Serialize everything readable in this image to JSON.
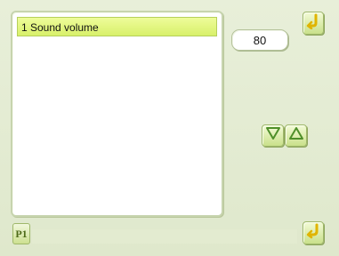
{
  "list": {
    "items": [
      {
        "label": "1 Sound volume",
        "selected": true
      }
    ]
  },
  "value": "80",
  "pager_label": "P1",
  "icons": {
    "top_button": "return-arrow-icon",
    "down_button": "down-triangle-icon",
    "up_button": "up-triangle-icon",
    "bottom_button": "enter-arrow-icon"
  },
  "colors": {
    "background": "#e6eed6",
    "selection": "#d8f06a",
    "button": "#c9e08a",
    "icon": "#e0b400"
  }
}
